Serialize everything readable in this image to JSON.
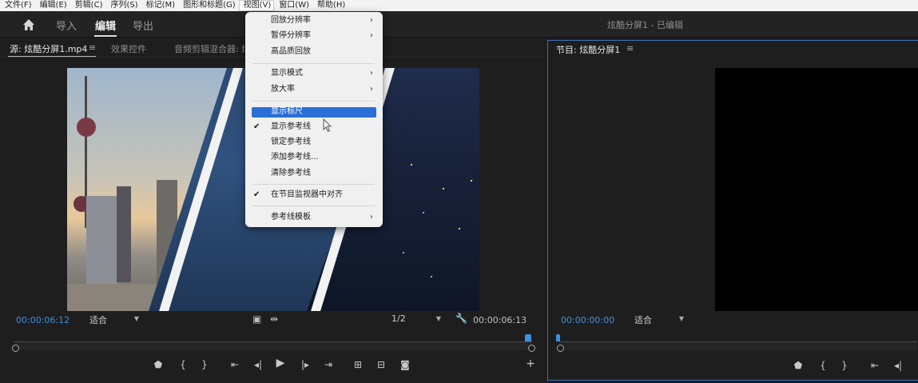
{
  "menubar": {
    "items": [
      "文件(F)",
      "编辑(E)",
      "剪辑(C)",
      "序列(S)",
      "标记(M)",
      "图形和标题(G)",
      "视图(V)",
      "窗口(W)",
      "帮助(H)"
    ]
  },
  "workspace": {
    "tabs": [
      "导入",
      "编辑",
      "导出"
    ],
    "active_tab": "编辑",
    "document_title": "炫酷分屏1 - 已编辑"
  },
  "source_panel": {
    "tabs": [
      "源: 炫酷分屏1.mp4",
      "效果控件",
      "音频剪辑混合器: 炫"
    ],
    "current_time": "00:00:06:12",
    "fit_label": "适合",
    "resolution_label": "1/2",
    "duration": "00:00:06:13"
  },
  "program_panel": {
    "tab": "节目: 炫酷分屏1",
    "current_time": "00:00:00:00",
    "fit_label": "适合"
  },
  "view_menu": {
    "items": [
      {
        "label": "回放分辨率",
        "submenu": true
      },
      {
        "label": "暂停分辨率",
        "submenu": true
      },
      {
        "label": "高品质回放"
      },
      {
        "label": "显示模式",
        "submenu": true
      },
      {
        "label": "放大率",
        "submenu": true
      },
      {
        "label": "显示标尺",
        "highlighted": true
      },
      {
        "label": "显示参考线",
        "checked": true
      },
      {
        "label": "锁定参考线"
      },
      {
        "label": "添加参考线..."
      },
      {
        "label": "清除参考线"
      },
      {
        "label": "在节目监视器中对齐",
        "checked": true
      },
      {
        "label": "参考线模板",
        "submenu": true
      }
    ]
  },
  "colors": {
    "accent_blue": "#2b6fd6",
    "timecode_blue": "#3f8fe0",
    "panel_border": "#3b72b8"
  }
}
